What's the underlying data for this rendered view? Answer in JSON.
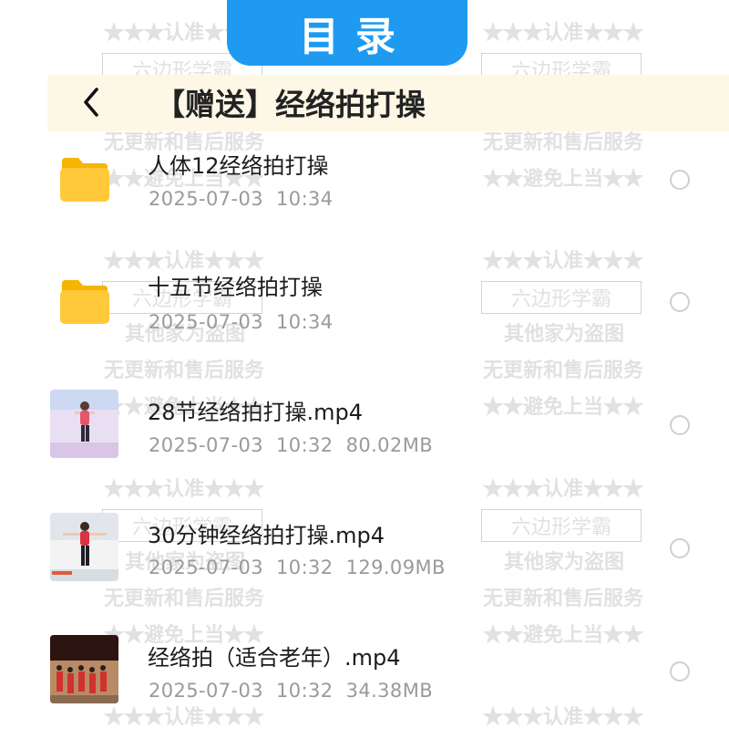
{
  "tab": {
    "title": "目录"
  },
  "header": {
    "title": "【赠送】经络拍打操",
    "back_icon": "chevron-left-icon"
  },
  "watermark": {
    "line1": "★★★认准★★★",
    "line2": "六边形学霸",
    "line3": "其他家为盗图",
    "line4": "无更新和售后服务",
    "line5": "★★避免上当★★"
  },
  "files": [
    {
      "type": "folder",
      "name": "人体12经络拍打操",
      "date": "2025-07-03",
      "time": "10:34",
      "size": ""
    },
    {
      "type": "folder",
      "name": "十五节经络拍打操",
      "date": "2025-07-03",
      "time": "10:34",
      "size": ""
    },
    {
      "type": "video",
      "name": "28节经络拍打操.mp4",
      "date": "2025-07-03",
      "time": "10:32",
      "size": "80.02MB"
    },
    {
      "type": "video",
      "name": "30分钟经络拍打操.mp4",
      "date": "2025-07-03",
      "time": "10:32",
      "size": "129.09MB"
    },
    {
      "type": "video",
      "name": "经络拍（适合老年）.mp4",
      "date": "2025-07-03",
      "time": "10:32",
      "size": "34.38MB"
    }
  ],
  "colors": {
    "accent": "#1e9bf0",
    "header_band": "#fdf8e6",
    "folder": "#ffc93a",
    "meta_text": "#9a9a9a"
  }
}
